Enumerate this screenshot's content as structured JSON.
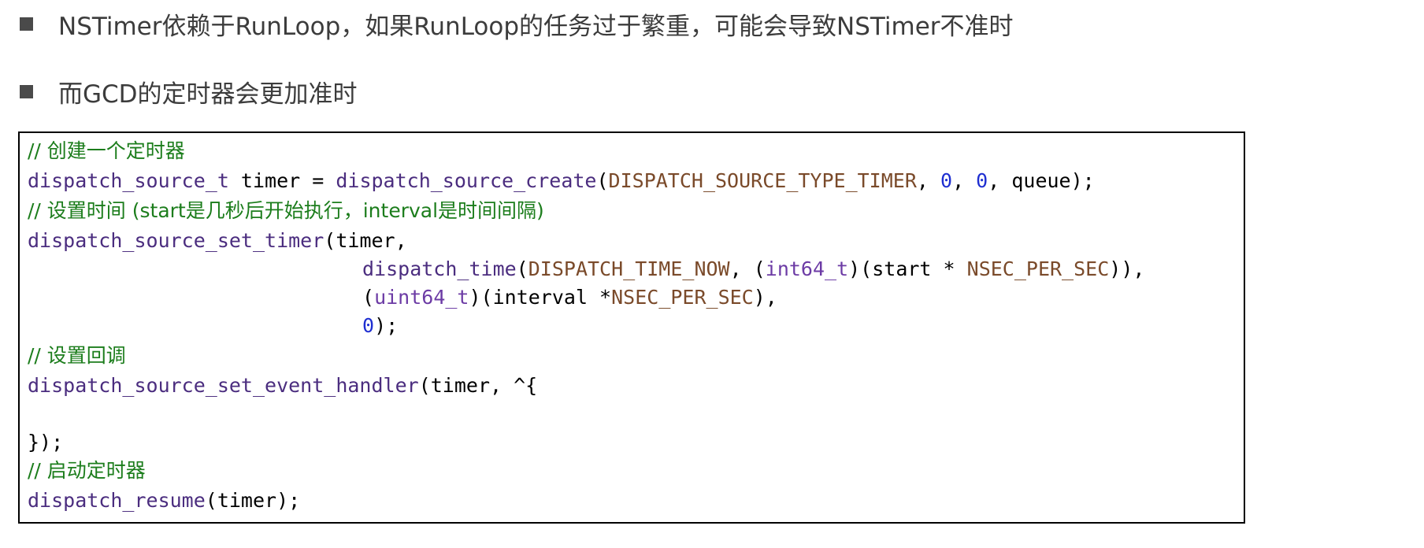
{
  "bullets": [
    "NSTimer依赖于RunLoop，如果RunLoop的任务过于繁重，可能会导致NSTimer不准时",
    "而GCD的定时器会更加准时"
  ],
  "colors": {
    "comment": "#1c7d1c",
    "function": "#4b2d7f",
    "constant": "#7a4a2a",
    "type": "#6c3ba5",
    "number": "#1f2fd1",
    "plain": "#000000",
    "bullet_text": "#3c3c3c",
    "bullet_marker": "#4a4a4a"
  },
  "code": {
    "line1": {
      "comment": "// 创建一个定时器"
    },
    "line2": {
      "t1": "dispatch_source_t",
      "t2": " timer = ",
      "t3": "dispatch_source_create",
      "t4": "(",
      "t5": "DISPATCH_SOURCE_TYPE_TIMER",
      "t6": ", ",
      "t7": "0",
      "t8": ", ",
      "t9": "0",
      "t10": ", queue);"
    },
    "line3": {
      "comment": "// 设置时间 (start是几秒后开始执行，interval是时间间隔)"
    },
    "line4": {
      "t1": "dispatch_source_set_timer",
      "t2": "(timer,"
    },
    "line5": {
      "t1": "dispatch_time",
      "t2": "(",
      "t3": "DISPATCH_TIME_NOW",
      "t4": ", (",
      "t5": "int64_t",
      "t6": ")(start * ",
      "t7": "NSEC_PER_SEC",
      "t8": ")),"
    },
    "line6": {
      "t1": "(",
      "t2": "uint64_t",
      "t3": ")(interval *",
      "t4": "NSEC_PER_SEC",
      "t5": "),"
    },
    "line7": {
      "t1": "0",
      "t2": ");"
    },
    "line8": {
      "comment": "// 设置回调"
    },
    "line9": {
      "t1": "dispatch_source_set_event_handler",
      "t2": "(timer, ^{"
    },
    "line11": {
      "t1": "});"
    },
    "line12": {
      "comment": "// 启动定时器"
    },
    "line13": {
      "t1": "dispatch_resume",
      "t2": "(timer);"
    }
  }
}
